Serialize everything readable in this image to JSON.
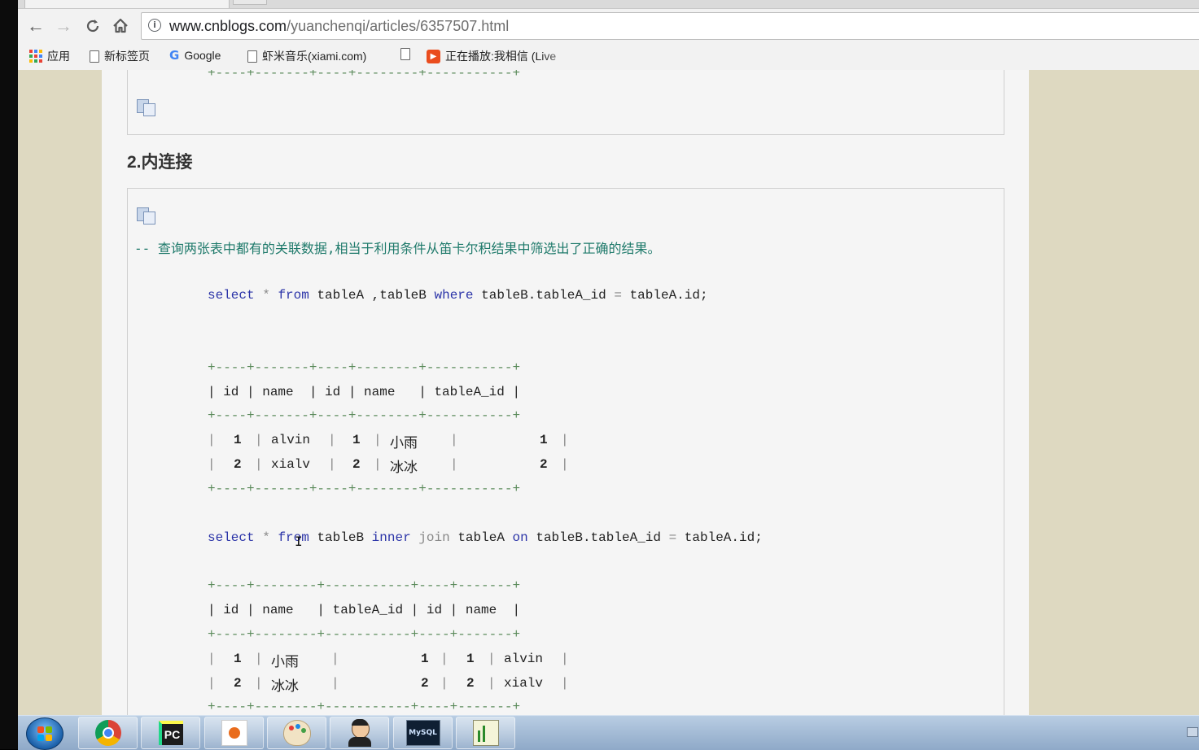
{
  "browser": {
    "url_host": "www.cnblogs.com",
    "url_path": "/yuanchenqi/articles/6357507.html",
    "back_glyph": "←",
    "forward_glyph": "→",
    "reload_glyph": "C",
    "home_glyph": "⌂",
    "info_glyph": "i"
  },
  "bookmarks": [
    {
      "icon": "apps-grid-icon",
      "label": "应用"
    },
    {
      "icon": "page-icon",
      "label": "新标签页"
    },
    {
      "icon": "google-icon",
      "label": "Google"
    },
    {
      "icon": "page-icon",
      "label": "虾米音乐(xiami.com)"
    },
    {
      "icon": "page-icon",
      "label": ""
    },
    {
      "icon": "play-icon",
      "label": "正在播放:我相信 (Live"
    }
  ],
  "article": {
    "box1_sep": "+----+-------+----+--------+-----------+",
    "heading": "2.内连接",
    "comment": "-- 查询两张表中都有的关联数据,相当于利用条件从笛卡尔积结果中筛选出了正确的结果。",
    "q1": {
      "select": "select",
      "star": "*",
      "from": "from",
      "tables": "tableA ,tableB",
      "where": "where",
      "cond_left": "tableB.tableA_id",
      "eq": "=",
      "cond_right": "tableA.id;"
    },
    "t1": {
      "sep": "+----+-------+----+--------+-----------+",
      "header": "| id | name  | id | name   | tableA_id |",
      "rows": [
        {
          "id1": "1",
          "name1": "alvin",
          "id2": "1",
          "name2": "小雨",
          "ref": "1"
        },
        {
          "id1": "2",
          "name1": "xialv",
          "id2": "2",
          "name2": "冰冰",
          "ref": "2"
        }
      ]
    },
    "q2": {
      "select": "select",
      "star": "*",
      "from": "from",
      "t1": "tableB",
      "inner": "inner",
      "join": "join",
      "t2": "tableA",
      "on": "on",
      "cond_left": "tableB.tableA_id",
      "eq": "=",
      "cond_right": "tableA.id;"
    },
    "t2": {
      "sep": "+----+--------+-----------+----+-------+",
      "header": "| id | name   | tableA_id | id | name  |",
      "rows": [
        {
          "id1": "1",
          "name1": "小雨",
          "ref": "1",
          "id2": "1",
          "name2": "alvin"
        },
        {
          "id1": "2",
          "name1": "冰冰",
          "ref": "2",
          "id2": "2",
          "name2": "xialv"
        }
      ]
    }
  },
  "taskbar": {
    "items": [
      "start-orb",
      "chrome",
      "pycharm",
      "powerpoint",
      "paint",
      "avatar-app",
      "mysql",
      "notepad"
    ],
    "pycharm_label": "PC",
    "mysql_label": "MySQL"
  },
  "colors": {
    "page_bg": "#ded9c1",
    "content_bg": "#f5f5f5",
    "keyword": "#2b34a8",
    "comment": "#1f7a6b"
  }
}
